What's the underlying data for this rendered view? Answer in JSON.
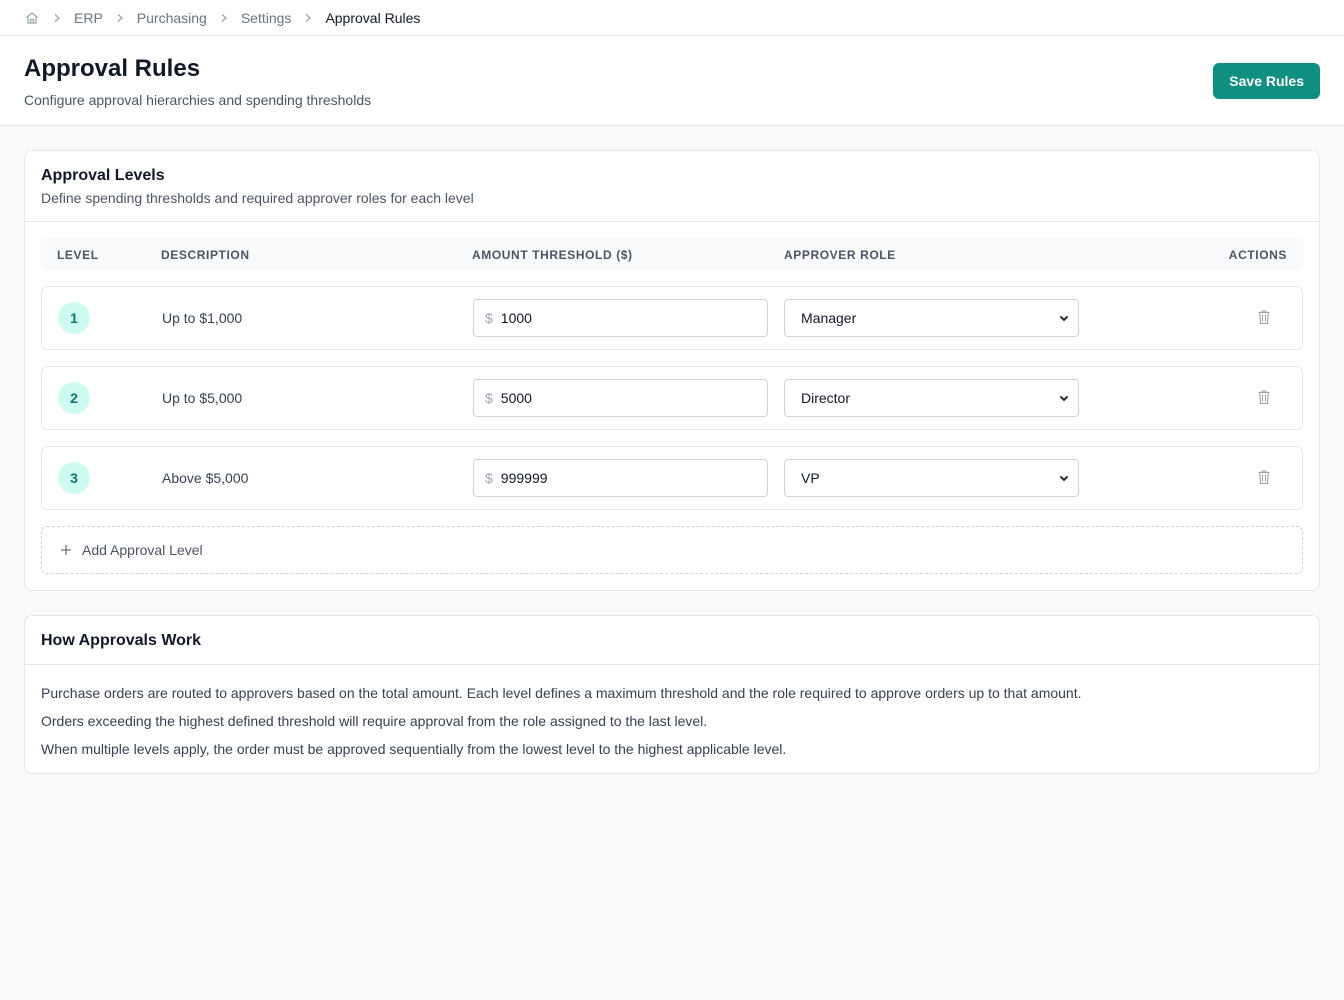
{
  "breadcrumb": {
    "items": [
      "ERP",
      "Purchasing",
      "Settings"
    ],
    "current": "Approval Rules"
  },
  "header": {
    "title": "Approval Rules",
    "subtitle": "Configure approval hierarchies and spending thresholds",
    "save_label": "Save Rules"
  },
  "levels": {
    "title": "Approval Levels",
    "subtitle": "Define spending thresholds and required approver roles for each level",
    "columns": [
      "LEVEL",
      "DESCRIPTION",
      "AMOUNT THRESHOLD ($)",
      "APPROVER ROLE",
      "ACTIONS"
    ],
    "currency_symbol": "$",
    "rows": [
      {
        "level": "1",
        "description": "Up to $1,000",
        "amount": "1000",
        "role": "Manager"
      },
      {
        "level": "2",
        "description": "Up to $5,000",
        "amount": "5000",
        "role": "Director"
      },
      {
        "level": "3",
        "description": "Above $5,000",
        "amount": "999999",
        "role": "VP"
      }
    ],
    "add_label": "Add Approval Level"
  },
  "how": {
    "title": "How Approvals Work",
    "paragraphs": [
      "Purchase orders are routed to approvers based on the total amount. Each level defines a maximum threshold and the role required to approve orders up to that amount.",
      "Orders exceeding the highest defined threshold will require approval from the role assigned to the last level.",
      "When multiple levels apply, the order must be approved sequentially from the lowest level to the highest applicable level."
    ]
  },
  "colors": {
    "accent": "#0f8f7f",
    "badge_bg": "#ccfbf1",
    "badge_text": "#0f766e"
  },
  "icons": {
    "home": "home-icon",
    "separator": "chevron-right-icon",
    "delete": "trash-icon",
    "add": "plus-icon",
    "select": "chevron-down-icon"
  }
}
